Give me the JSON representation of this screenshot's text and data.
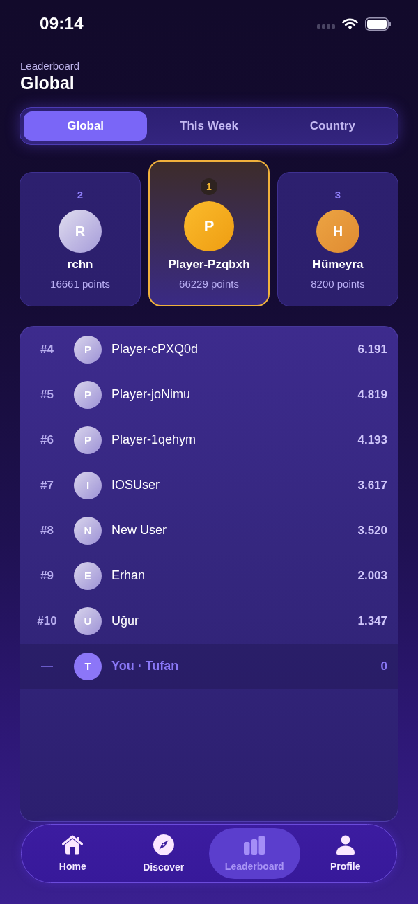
{
  "status_bar": {
    "time": "09:14"
  },
  "header": {
    "subtitle": "Leaderboard",
    "title": "Global"
  },
  "tabs": [
    {
      "label": "Global",
      "selected": true
    },
    {
      "label": "This Week",
      "selected": false
    },
    {
      "label": "Country",
      "selected": false
    }
  ],
  "podium": [
    {
      "kind": "silver",
      "rank": "2",
      "initial": "R",
      "name": "rchn",
      "points": "16661 points"
    },
    {
      "kind": "gold",
      "rank": "1",
      "initial": "P",
      "name": "Player-Pzqbxh",
      "points": "66229 points"
    },
    {
      "kind": "bronze",
      "rank": "3",
      "initial": "H",
      "name": "Hümeyra",
      "points": "8200 points"
    }
  ],
  "rankings": [
    {
      "kind": "player",
      "rank": "#4",
      "initial": "P",
      "name": "Player-cPXQ0d",
      "score": "6.191"
    },
    {
      "kind": "player",
      "rank": "#5",
      "initial": "P",
      "name": "Player-joNimu",
      "score": "4.819"
    },
    {
      "kind": "player",
      "rank": "#6",
      "initial": "P",
      "name": "Player-1qehym",
      "score": "4.193"
    },
    {
      "kind": "player",
      "rank": "#7",
      "initial": "I",
      "name": "IOSUser",
      "score": "3.617"
    },
    {
      "kind": "player",
      "rank": "#8",
      "initial": "N",
      "name": "New User",
      "score": "3.520"
    },
    {
      "kind": "player",
      "rank": "#9",
      "initial": "E",
      "name": "Erhan",
      "score": "2.003"
    },
    {
      "kind": "player",
      "rank": "#10",
      "initial": "U",
      "name": "Uğur",
      "score": "1.347"
    },
    {
      "kind": "self",
      "rank": "—",
      "initial": "T",
      "name": "You · Tufan",
      "score": "0"
    }
  ],
  "tab_bar": [
    {
      "kind": "home",
      "label": "Home",
      "selected": false
    },
    {
      "kind": "discover",
      "label": "Discover",
      "selected": false
    },
    {
      "kind": "leaderboard",
      "label": "Leaderboard",
      "selected": true
    },
    {
      "kind": "profile",
      "label": "Profile",
      "selected": false
    }
  ]
}
